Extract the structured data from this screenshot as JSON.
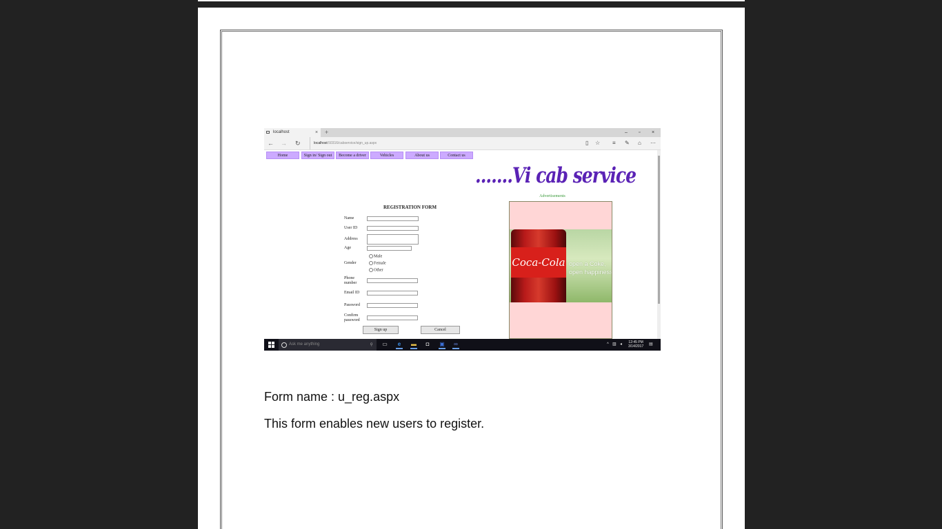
{
  "browser": {
    "tab_title": "localhost",
    "tab_close": "×",
    "new_tab": "+",
    "url_host": "localhost",
    "url_path": ":50316/cabservice/sign_up.aspx",
    "icons": [
      "back-arrow-icon",
      "forward-arrow-icon",
      "refresh-icon",
      "reading-view-icon",
      "favorite-star-icon",
      "hub-icon",
      "web-note-icon",
      "share-icon",
      "more-icon"
    ],
    "window_controls": [
      "–",
      "▫",
      "×"
    ]
  },
  "site": {
    "menu": [
      "Home",
      "Sign in/ Sign out",
      "Become a driver",
      "Vehicles",
      "About us",
      "Contact us"
    ],
    "logo_text": ".......Vi cab service",
    "ad_label": "Advertisements",
    "ad_brand": "Coca-Cola",
    "ad_slogan_1": "open a Coke,",
    "ad_slogan_2": "open happiness"
  },
  "form": {
    "title": "REGISTRATION FORM",
    "labels": {
      "name": "Name",
      "user_id": "User ID",
      "address": "Address",
      "age": "Age",
      "gender": "Gender",
      "phone": "Phone number",
      "email": "Email ID",
      "password": "Password",
      "confirm": "Confirm password"
    },
    "gender_options": [
      "Male",
      "Female",
      "Other"
    ],
    "signup_label": "Sign up",
    "cancel_label": "Cancel"
  },
  "taskbar": {
    "search_placeholder": "Ask me anything",
    "time": "12:45 PM",
    "date": "3/14/2017"
  },
  "document": {
    "form_name": "Form name  : u_reg.aspx",
    "description": "This form enables new users to register."
  }
}
